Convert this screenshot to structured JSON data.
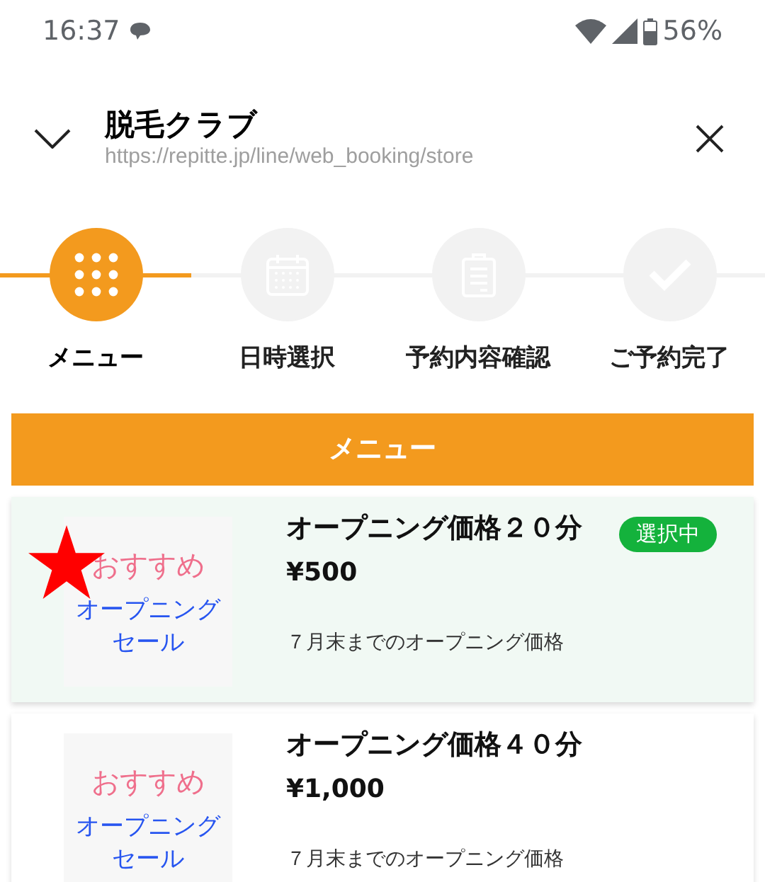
{
  "status_bar": {
    "time": "16:37",
    "battery": "56%"
  },
  "header": {
    "title": "脱毛クラブ",
    "url": "https://repitte.jp/line/web_booking/store"
  },
  "steps": [
    {
      "kind": "menu",
      "label": "メニュー",
      "selected": true
    },
    {
      "kind": "calendar",
      "label": "日時選択",
      "selected": false
    },
    {
      "kind": "clipboard",
      "label": "予約内容確認",
      "selected": false
    },
    {
      "kind": "check",
      "label": "ご予約完了",
      "selected": false
    }
  ],
  "section_title": "メニュー",
  "menu_items": [
    {
      "thumb_top": "おすすめ",
      "thumb_lines": [
        "オープニング",
        "セール"
      ],
      "title": "オープニング価格２０分",
      "price": "¥500",
      "note": "７月末までのオープニング価格",
      "selected": true,
      "badge": "選択中",
      "starred": true
    },
    {
      "thumb_top": "おすすめ",
      "thumb_lines": [
        "オープニング",
        "セール"
      ],
      "title": "オープニング価格４０分",
      "price": "¥1,000",
      "note": "７月末までのオープニング価格",
      "selected": false,
      "starred": false
    }
  ]
}
